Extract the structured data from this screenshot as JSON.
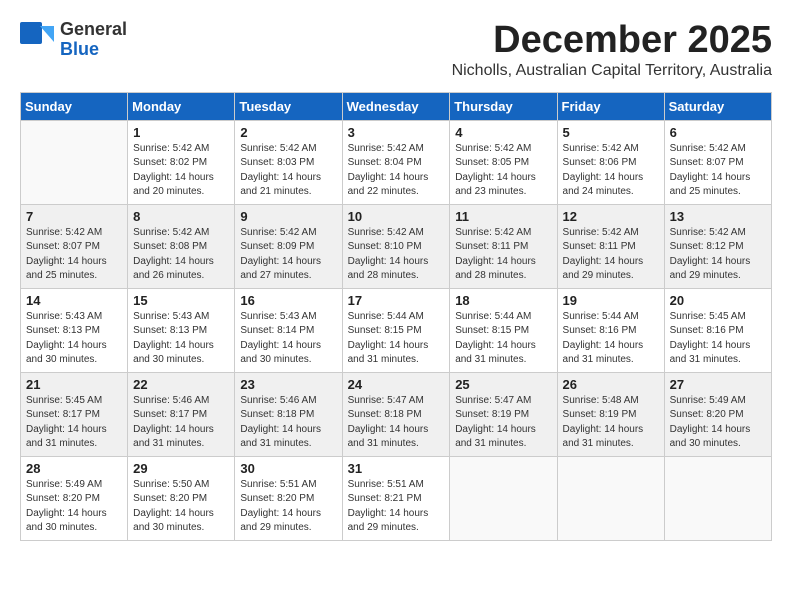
{
  "logo": {
    "general": "General",
    "blue": "Blue"
  },
  "title": "December 2025",
  "subtitle": "Nicholls, Australian Capital Territory, Australia",
  "days_of_week": [
    "Sunday",
    "Monday",
    "Tuesday",
    "Wednesday",
    "Thursday",
    "Friday",
    "Saturday"
  ],
  "weeks": [
    [
      {
        "day": "",
        "info": ""
      },
      {
        "day": "1",
        "info": "Sunrise: 5:42 AM\nSunset: 8:02 PM\nDaylight: 14 hours\nand 20 minutes."
      },
      {
        "day": "2",
        "info": "Sunrise: 5:42 AM\nSunset: 8:03 PM\nDaylight: 14 hours\nand 21 minutes."
      },
      {
        "day": "3",
        "info": "Sunrise: 5:42 AM\nSunset: 8:04 PM\nDaylight: 14 hours\nand 22 minutes."
      },
      {
        "day": "4",
        "info": "Sunrise: 5:42 AM\nSunset: 8:05 PM\nDaylight: 14 hours\nand 23 minutes."
      },
      {
        "day": "5",
        "info": "Sunrise: 5:42 AM\nSunset: 8:06 PM\nDaylight: 14 hours\nand 24 minutes."
      },
      {
        "day": "6",
        "info": "Sunrise: 5:42 AM\nSunset: 8:07 PM\nDaylight: 14 hours\nand 25 minutes."
      }
    ],
    [
      {
        "day": "7",
        "info": "Sunrise: 5:42 AM\nSunset: 8:07 PM\nDaylight: 14 hours\nand 25 minutes."
      },
      {
        "day": "8",
        "info": "Sunrise: 5:42 AM\nSunset: 8:08 PM\nDaylight: 14 hours\nand 26 minutes."
      },
      {
        "day": "9",
        "info": "Sunrise: 5:42 AM\nSunset: 8:09 PM\nDaylight: 14 hours\nand 27 minutes."
      },
      {
        "day": "10",
        "info": "Sunrise: 5:42 AM\nSunset: 8:10 PM\nDaylight: 14 hours\nand 28 minutes."
      },
      {
        "day": "11",
        "info": "Sunrise: 5:42 AM\nSunset: 8:11 PM\nDaylight: 14 hours\nand 28 minutes."
      },
      {
        "day": "12",
        "info": "Sunrise: 5:42 AM\nSunset: 8:11 PM\nDaylight: 14 hours\nand 29 minutes."
      },
      {
        "day": "13",
        "info": "Sunrise: 5:42 AM\nSunset: 8:12 PM\nDaylight: 14 hours\nand 29 minutes."
      }
    ],
    [
      {
        "day": "14",
        "info": "Sunrise: 5:43 AM\nSunset: 8:13 PM\nDaylight: 14 hours\nand 30 minutes."
      },
      {
        "day": "15",
        "info": "Sunrise: 5:43 AM\nSunset: 8:13 PM\nDaylight: 14 hours\nand 30 minutes."
      },
      {
        "day": "16",
        "info": "Sunrise: 5:43 AM\nSunset: 8:14 PM\nDaylight: 14 hours\nand 30 minutes."
      },
      {
        "day": "17",
        "info": "Sunrise: 5:44 AM\nSunset: 8:15 PM\nDaylight: 14 hours\nand 31 minutes."
      },
      {
        "day": "18",
        "info": "Sunrise: 5:44 AM\nSunset: 8:15 PM\nDaylight: 14 hours\nand 31 minutes."
      },
      {
        "day": "19",
        "info": "Sunrise: 5:44 AM\nSunset: 8:16 PM\nDaylight: 14 hours\nand 31 minutes."
      },
      {
        "day": "20",
        "info": "Sunrise: 5:45 AM\nSunset: 8:16 PM\nDaylight: 14 hours\nand 31 minutes."
      }
    ],
    [
      {
        "day": "21",
        "info": "Sunrise: 5:45 AM\nSunset: 8:17 PM\nDaylight: 14 hours\nand 31 minutes."
      },
      {
        "day": "22",
        "info": "Sunrise: 5:46 AM\nSunset: 8:17 PM\nDaylight: 14 hours\nand 31 minutes."
      },
      {
        "day": "23",
        "info": "Sunrise: 5:46 AM\nSunset: 8:18 PM\nDaylight: 14 hours\nand 31 minutes."
      },
      {
        "day": "24",
        "info": "Sunrise: 5:47 AM\nSunset: 8:18 PM\nDaylight: 14 hours\nand 31 minutes."
      },
      {
        "day": "25",
        "info": "Sunrise: 5:47 AM\nSunset: 8:19 PM\nDaylight: 14 hours\nand 31 minutes."
      },
      {
        "day": "26",
        "info": "Sunrise: 5:48 AM\nSunset: 8:19 PM\nDaylight: 14 hours\nand 31 minutes."
      },
      {
        "day": "27",
        "info": "Sunrise: 5:49 AM\nSunset: 8:20 PM\nDaylight: 14 hours\nand 30 minutes."
      }
    ],
    [
      {
        "day": "28",
        "info": "Sunrise: 5:49 AM\nSunset: 8:20 PM\nDaylight: 14 hours\nand 30 minutes."
      },
      {
        "day": "29",
        "info": "Sunrise: 5:50 AM\nSunset: 8:20 PM\nDaylight: 14 hours\nand 30 minutes."
      },
      {
        "day": "30",
        "info": "Sunrise: 5:51 AM\nSunset: 8:20 PM\nDaylight: 14 hours\nand 29 minutes."
      },
      {
        "day": "31",
        "info": "Sunrise: 5:51 AM\nSunset: 8:21 PM\nDaylight: 14 hours\nand 29 minutes."
      },
      {
        "day": "",
        "info": ""
      },
      {
        "day": "",
        "info": ""
      },
      {
        "day": "",
        "info": ""
      }
    ]
  ]
}
